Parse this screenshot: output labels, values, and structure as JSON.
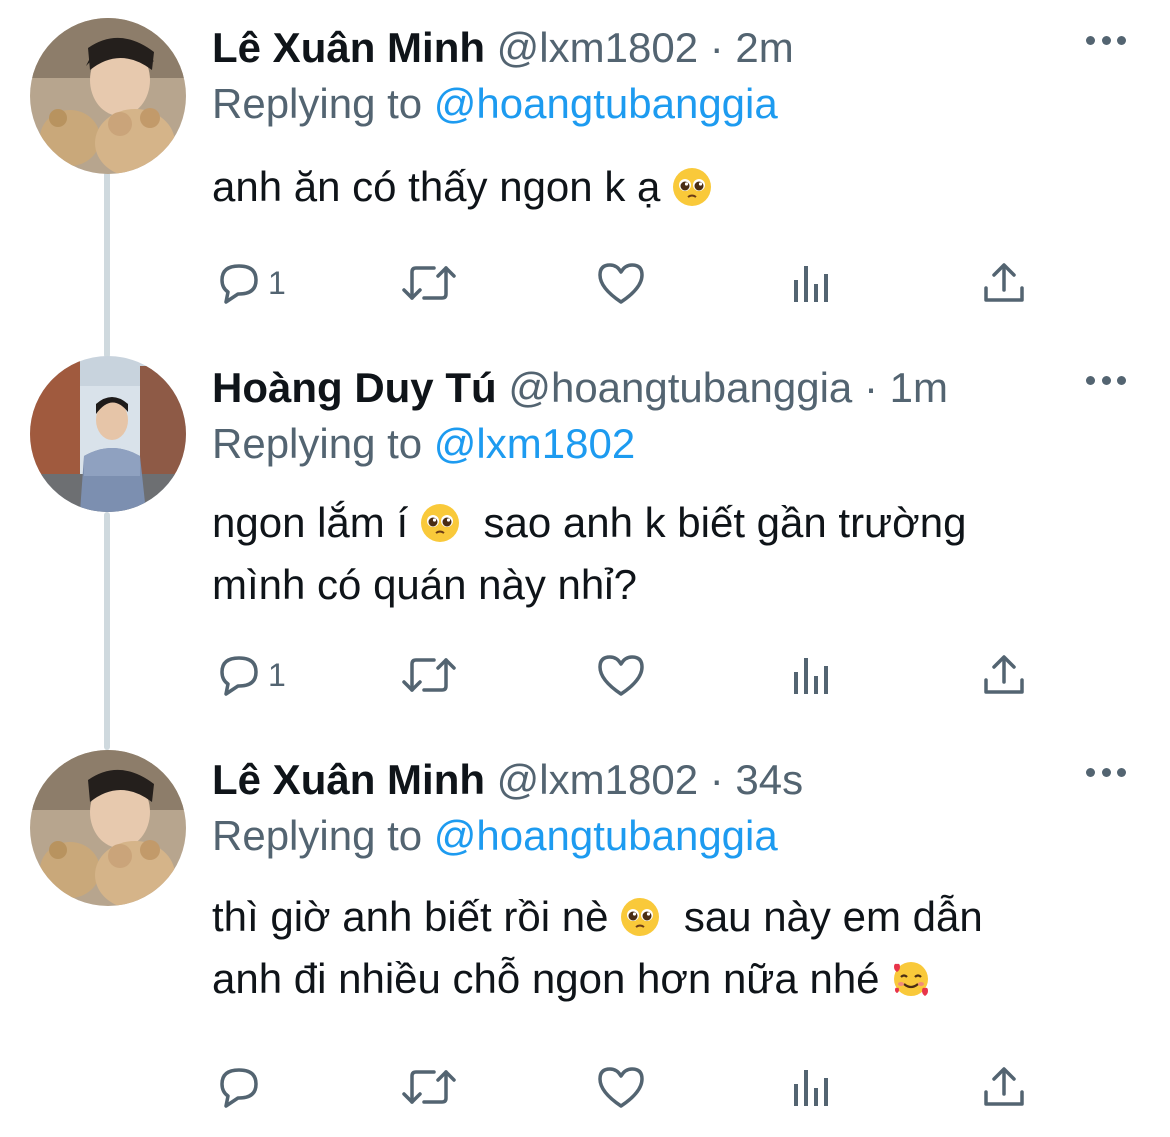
{
  "tweets": [
    {
      "name": "Lê Xuân Minh",
      "handle": "@lxm1802",
      "separator": "·",
      "time": "2m",
      "replying_label": "Replying to",
      "replying_to": "@hoangtubanggia",
      "text_parts": [
        "anh ăn có thấy ngon k ạ"
      ],
      "reply_count": "1"
    },
    {
      "name": "Hoàng Duy Tú",
      "handle": "@hoangtubanggia",
      "separator": "·",
      "time": "1m",
      "replying_label": "Replying to",
      "replying_to": "@lxm1802",
      "text_line1_a": "ngon lắm í",
      "text_line1_b": "sao anh k biết gần trường",
      "text_line2": "mình có quán này nhỉ?",
      "reply_count": "1"
    },
    {
      "name": "Lê Xuân Minh",
      "handle": "@lxm1802",
      "separator": "·",
      "time": "34s",
      "replying_label": "Replying to",
      "replying_to": "@hoangtubanggia",
      "text_line1_a": "thì giờ anh biết rồi nè",
      "text_line1_b": "sau này em dẫn",
      "text_line2": "anh đi nhiều chỗ ngon hơn nữa nhé",
      "reply_count": ""
    }
  ],
  "colors": {
    "name": "#0f1419",
    "secondary": "#536471",
    "mention": "#1d9bf0",
    "thread_line": "#cfd9de"
  },
  "icons": [
    "reply-icon",
    "retweet-icon",
    "like-icon",
    "analytics-icon",
    "share-icon",
    "more-icon",
    "pleading-face-emoji",
    "smiling-face-with-hearts-emoji"
  ]
}
